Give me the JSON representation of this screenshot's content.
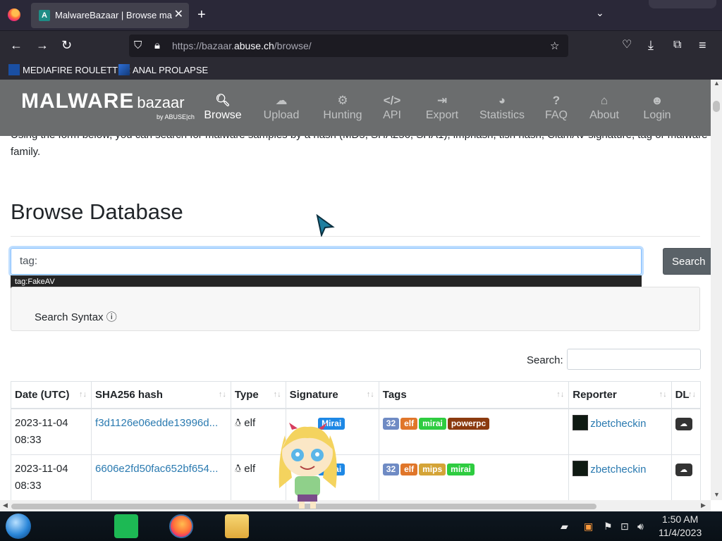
{
  "browser": {
    "tab_title": "MalwareBazaar | Browse malware",
    "tab_favicon": "A",
    "url_prefix": "https://bazaar.",
    "url_domain": "abuse.ch",
    "url_path": "/browse/",
    "bookmarks": [
      {
        "label": "MEDIAFIRE ROULETTER"
      },
      {
        "label": "ANAL PROLAPSE"
      }
    ]
  },
  "site": {
    "brand_main": "MALWARE",
    "brand_sub": "bazaar",
    "brand_by": "by ABUSE|ch",
    "nav": [
      {
        "label": "Browse",
        "icon": "search-icon"
      },
      {
        "label": "Upload",
        "icon": "cloud-upload-icon"
      },
      {
        "label": "Hunting",
        "icon": "hunting-icon"
      },
      {
        "label": "API",
        "icon": "code-icon"
      },
      {
        "label": "Export",
        "icon": "export-icon"
      },
      {
        "label": "Statistics",
        "icon": "pie-chart-icon"
      },
      {
        "label": "FAQ",
        "icon": "question-icon"
      },
      {
        "label": "About",
        "icon": "building-icon"
      },
      {
        "label": "Login",
        "icon": "user-icon"
      }
    ],
    "active_nav": "Browse"
  },
  "main": {
    "intro": "Using the form below, you can search for malware samples by a hash (MD5, SHA256, SHA1), imphash, tlsh hash, ClamAV signature, tag or malware family.",
    "title": "Browse Database",
    "search_value": "tag:",
    "search_button": "Search",
    "autocomplete": "tag:FakeAV",
    "syntax_label": "Search Syntax",
    "table_search_label": "Search:"
  },
  "table": {
    "columns": [
      "Date (UTC)",
      "SHA256 hash",
      "Type",
      "Signature",
      "Tags",
      "Reporter",
      "DL"
    ],
    "rows": [
      {
        "date": "2023-11-04",
        "time": "08:33",
        "hash": "f3d1126e06edde13996d...",
        "type": "elf",
        "signature": "Mirai",
        "tags": [
          "32",
          "elf",
          "mirai",
          "powerpc"
        ],
        "reporter": "zbetcheckin"
      },
      {
        "date": "2023-11-04",
        "time": "08:33",
        "hash": "6606e2fd50fac652bf654...",
        "type": "elf",
        "signature": "Mirai",
        "tags": [
          "32",
          "elf",
          "mips",
          "mirai"
        ],
        "reporter": "zbetcheckin"
      }
    ]
  },
  "tag_colors": {
    "32": "#6f8bc4",
    "elf": "#e0762a",
    "mirai": "#2ecc40",
    "mips": "#d4a437",
    "powerpc": "#8b3a0f"
  },
  "colors": {
    "navbar": "#6b6d6e",
    "signature_badge": "#1e88e5",
    "link": "#2a7ab0"
  },
  "taskbar": {
    "time": "1:50 AM",
    "date": "11/4/2023"
  }
}
